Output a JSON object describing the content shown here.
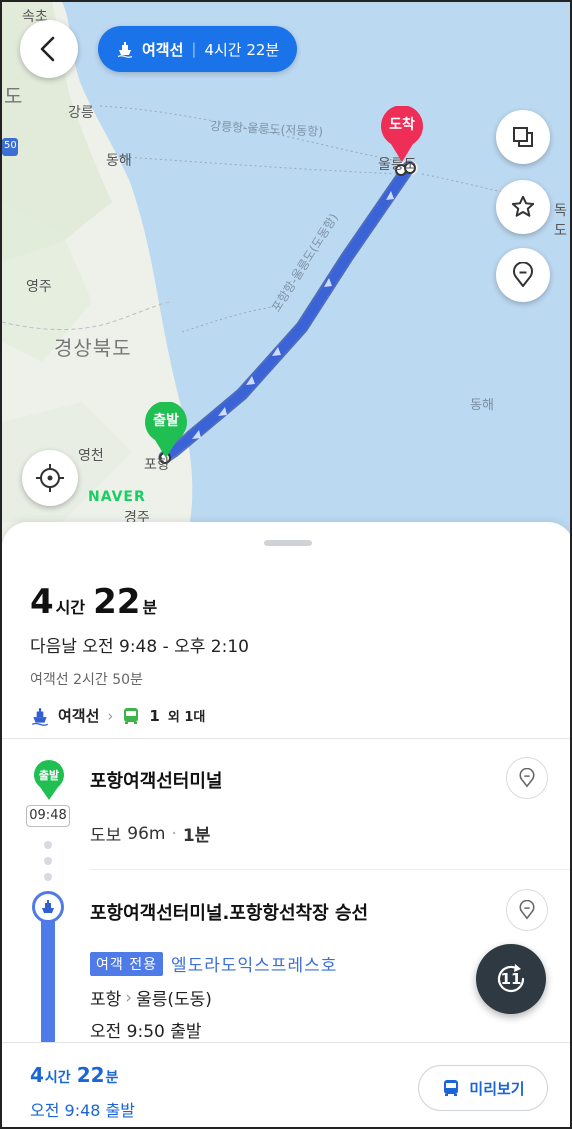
{
  "header": {
    "mode_label": "여객선",
    "duration": "4시간 22분"
  },
  "map": {
    "labels": {
      "sokcho": "속초",
      "do_left": "도",
      "gangneung": "강릉",
      "donghae_city": "동해",
      "yeongju": "영주",
      "gyeongbuk": "경상북도",
      "yeongcheon": "영천",
      "pohang": "포항",
      "gyeongju": "경주",
      "ulleung": "울릉도",
      "dokdo": "독도",
      "east_sea": "동해",
      "route_upper": "강릉항-울릉도(저동항)",
      "route_main": "포항항-울릉도(도동항)",
      "road_number": "50"
    },
    "pins": {
      "start": "출발",
      "end": "도착"
    },
    "logo": "NAVER",
    "colors": {
      "route": "#3a63d8",
      "start_pin": "#1fbf52",
      "end_pin": "#ee2e57"
    }
  },
  "summary": {
    "hours_num": "4",
    "hours_unit": "시간",
    "minutes_num": "22",
    "minutes_unit": "분",
    "time_range": "다음날 오전 9:48 - 오후 2:10",
    "sub_info": "여객선 2시간 50분",
    "mode1": "여객선",
    "mode2_num": "1",
    "mode2_rest": "외 1대"
  },
  "steps": {
    "start_badge": "출발",
    "start_title": "포항여객선터미널",
    "start_time": "09:48",
    "walk_label": "도보",
    "walk_dist": "96m",
    "walk_time": "1분",
    "board_title": "포항여객선터미널.포항항선착장 승선",
    "badge": "여객 전용",
    "ship_name": "엘도라도익스프레스호",
    "route_from": "포항",
    "route_to": "울릉(도동)",
    "depart": "오전 9:50 출발"
  },
  "float_button": {
    "label": "11"
  },
  "bottom_bar": {
    "hours_num": "4",
    "hours_unit": "시간",
    "minutes_num": "22",
    "minutes_unit": "분",
    "depart": "오전 9:48 출발",
    "preview_label": "미리보기"
  }
}
